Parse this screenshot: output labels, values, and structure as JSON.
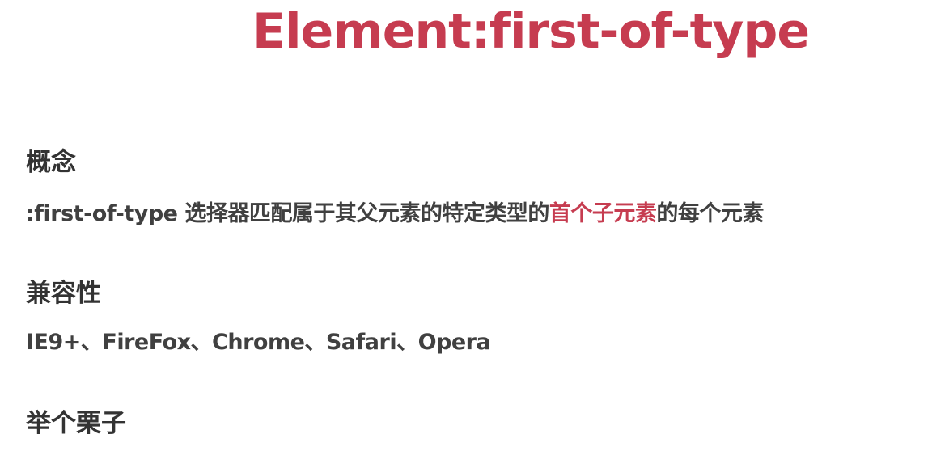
{
  "title": "Element:first-of-type",
  "sections": [
    {
      "heading": "概念",
      "text_before": ":first-of-type 选择器匹配属于其父元素的特定类型的",
      "highlight": "首个子元素",
      "text_after": "的每个元素"
    },
    {
      "heading": "兼容性",
      "text": "IE9+、FireFox、Chrome、Safari、Opera"
    },
    {
      "heading": "举个栗子"
    }
  ],
  "colors": {
    "accent": "#c63c50",
    "text": "#3a3a3a"
  }
}
